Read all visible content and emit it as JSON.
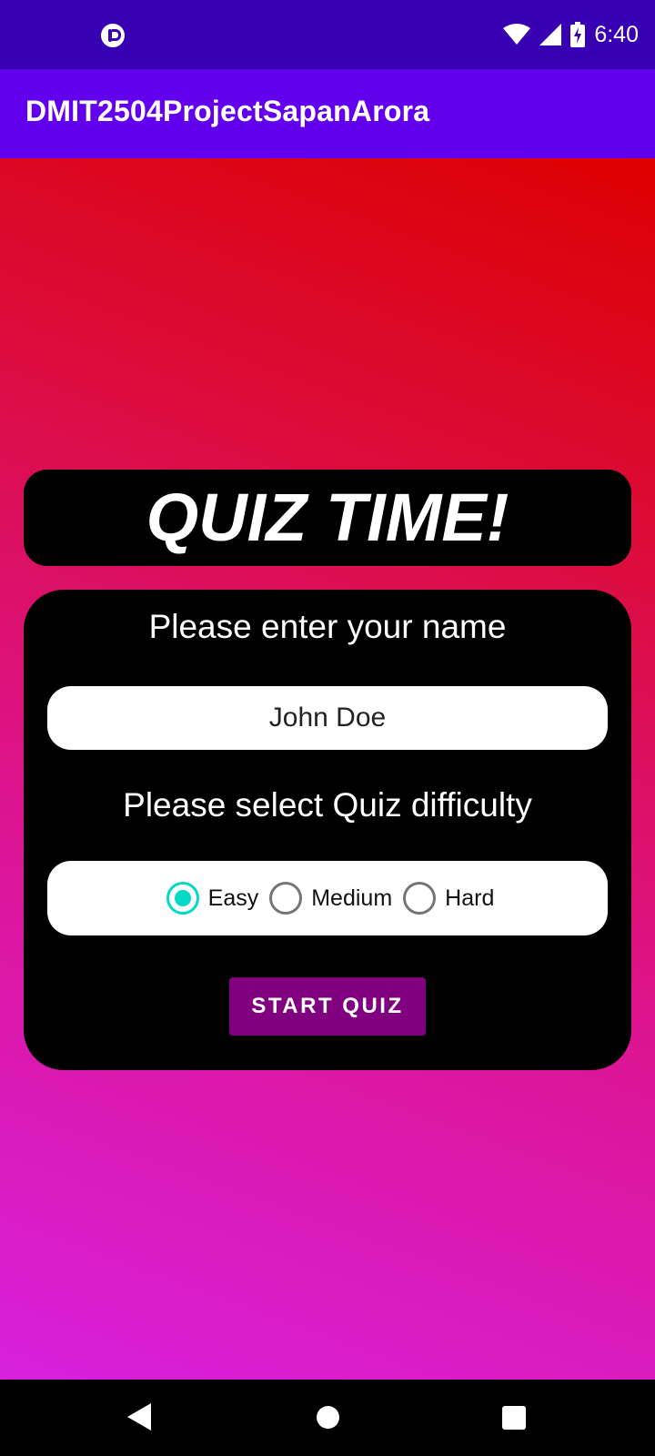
{
  "status_bar": {
    "time": "6:40",
    "left_icon": "app-notification-icon",
    "icons": [
      "wifi-icon",
      "cell-signal-icon",
      "battery-charging-icon"
    ]
  },
  "app_bar": {
    "title": "DMIT2504ProjectSapanArora"
  },
  "quiz": {
    "title": "QUIZ TIME!",
    "name_prompt": "Please enter your name",
    "name_value": "John Doe",
    "difficulty_prompt": "Please select Quiz difficulty",
    "difficulty_options": [
      "Easy",
      "Medium",
      "Hard"
    ],
    "selected_difficulty": "Easy",
    "start_button": "START QUIZ"
  },
  "nav_bar": {
    "icons": [
      "back-icon",
      "home-icon",
      "recents-icon"
    ]
  },
  "colors": {
    "status_bar": "#3700B3",
    "app_bar": "#6200EE",
    "gradient_top": "#DD0000",
    "gradient_bottom": "#D820DD",
    "radio_accent": "#03DAC5",
    "button": "#800080"
  }
}
